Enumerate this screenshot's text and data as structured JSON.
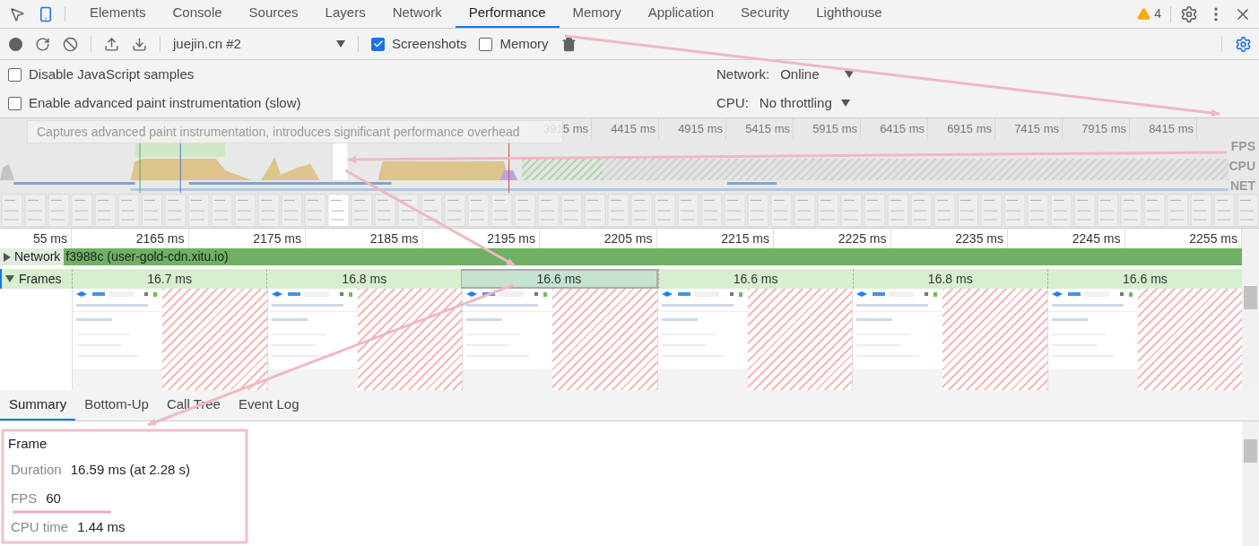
{
  "tabs": [
    {
      "label": "Elements",
      "selected": false
    },
    {
      "label": "Console",
      "selected": false
    },
    {
      "label": "Sources",
      "selected": false
    },
    {
      "label": "Layers",
      "selected": false
    },
    {
      "label": "Network",
      "selected": false
    },
    {
      "label": "Performance",
      "selected": true
    },
    {
      "label": "Memory",
      "selected": false
    },
    {
      "label": "Application",
      "selected": false
    },
    {
      "label": "Security",
      "selected": false
    },
    {
      "label": "Lighthouse",
      "selected": false
    }
  ],
  "warning_count": "4",
  "toolbar": {
    "target": "juejin.cn #2",
    "options": [
      {
        "label": "Screenshots",
        "checked": true
      },
      {
        "label": "Memory",
        "checked": false
      }
    ]
  },
  "settings": {
    "options": [
      {
        "label": "Disable JavaScript samples",
        "checked": false
      },
      {
        "label": "Enable advanced paint instrumentation (slow)",
        "checked": false
      }
    ],
    "network": {
      "label": "Network:",
      "value": "Online"
    },
    "cpu": {
      "label": "CPU:",
      "value": "No throttling"
    }
  },
  "tooltip": "Captures advanced paint instrumentation, introduces significant performance overhead",
  "overview": {
    "ticks": [
      "3915 ms",
      "4415 ms",
      "4915 ms",
      "5415 ms",
      "5915 ms",
      "6415 ms",
      "6915 ms",
      "7415 ms",
      "7915 ms",
      "8415 ms"
    ],
    "tracks": [
      "FPS",
      "CPU",
      "NET"
    ]
  },
  "timeline": {
    "ticks": [
      "55 ms",
      "2165 ms",
      "2175 ms",
      "2185 ms",
      "2195 ms",
      "2205 ms",
      "2215 ms",
      "2225 ms",
      "2235 ms",
      "2245 ms",
      "2255 ms"
    ],
    "network_track": {
      "label": "Network",
      "request": "f3988c (user-gold-cdn.xitu.io)",
      "expanded": false
    },
    "frames_track": {
      "label": "Frames",
      "expanded": true,
      "frames": [
        {
          "duration": "16.7 ms",
          "selected": false
        },
        {
          "duration": "16.8 ms",
          "selected": false
        },
        {
          "duration": "16.6 ms",
          "selected": true
        },
        {
          "duration": "16.6 ms",
          "selected": false
        },
        {
          "duration": "16.8 ms",
          "selected": false
        },
        {
          "duration": "16.6 ms",
          "selected": false
        }
      ]
    }
  },
  "detail_tabs": [
    {
      "label": "Summary",
      "selected": true
    },
    {
      "label": "Bottom-Up",
      "selected": false
    },
    {
      "label": "Call Tree",
      "selected": false
    },
    {
      "label": "Event Log",
      "selected": false
    }
  ],
  "summary": {
    "title": "Frame",
    "rows": [
      {
        "label": "Duration",
        "value": "16.59 ms (at 2.28 s)"
      },
      {
        "label": "FPS",
        "value": "60"
      },
      {
        "label": "CPU time",
        "value": "1.44 ms"
      }
    ]
  }
}
